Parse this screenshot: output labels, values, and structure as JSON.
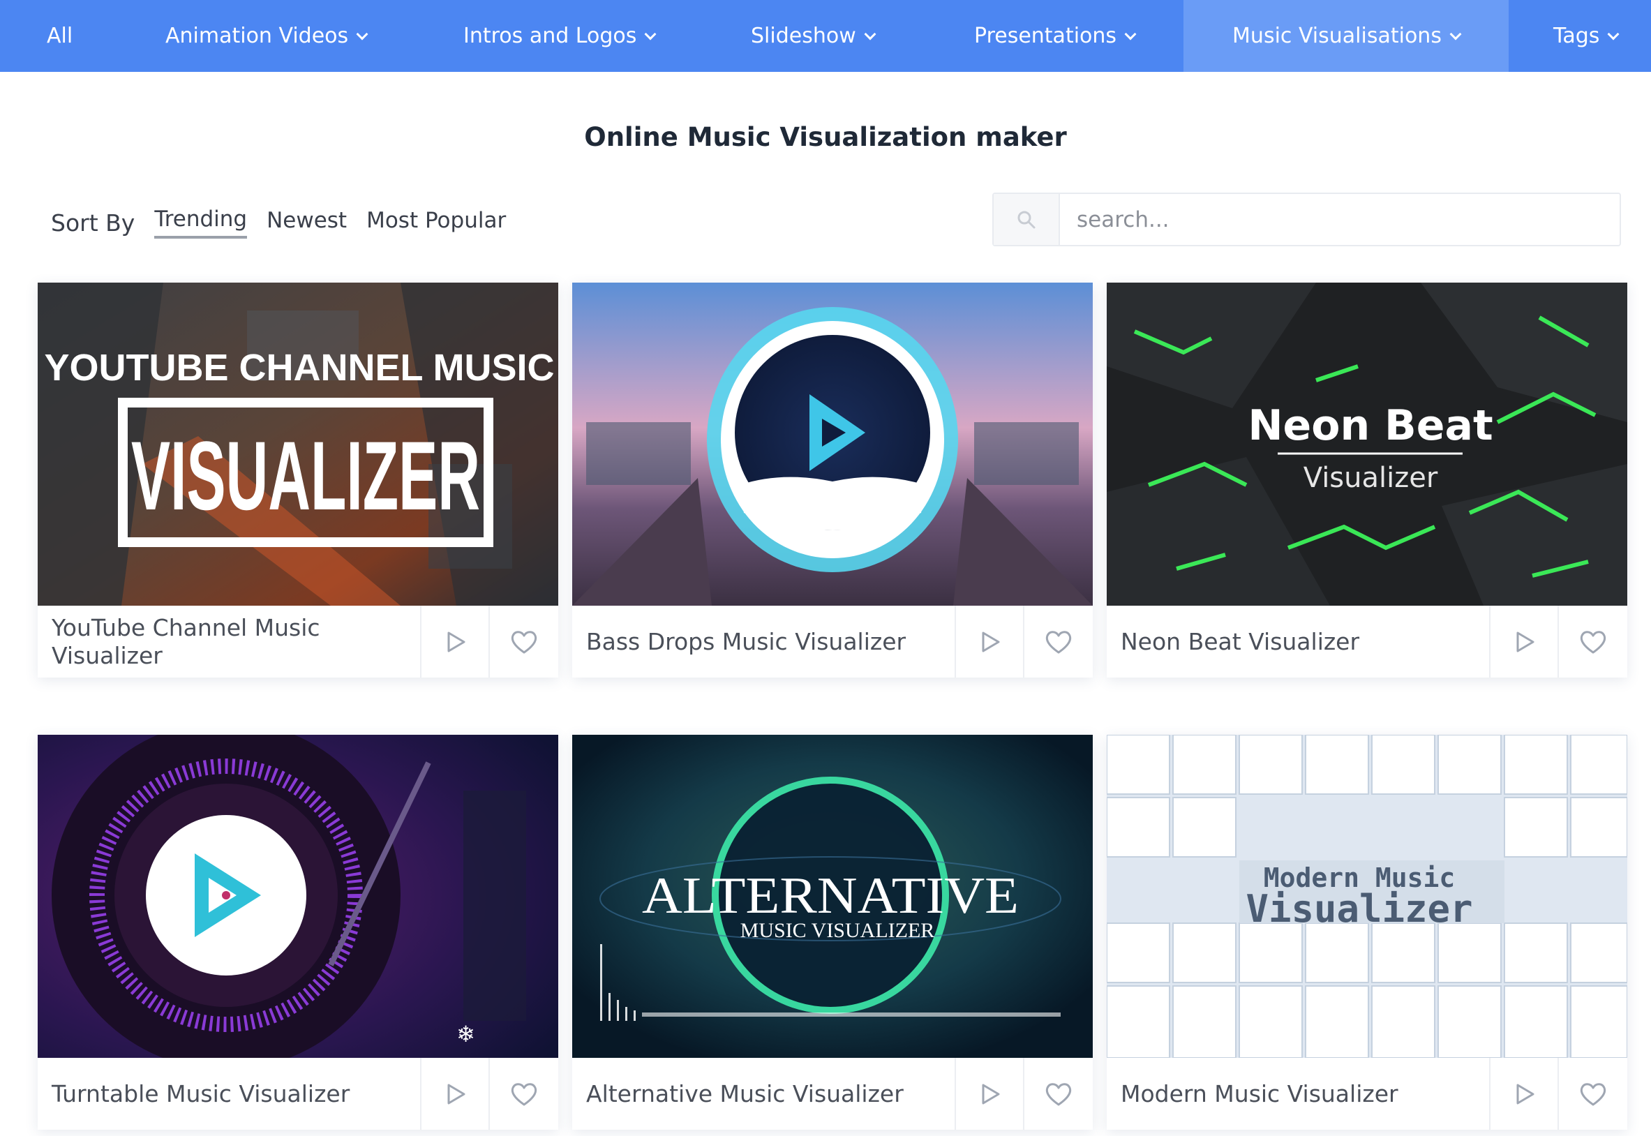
{
  "nav": {
    "items": [
      {
        "label": "All",
        "dropdown": false
      },
      {
        "label": "Animation Videos",
        "dropdown": true
      },
      {
        "label": "Intros and Logos",
        "dropdown": true
      },
      {
        "label": "Slideshow",
        "dropdown": true
      },
      {
        "label": "Presentations",
        "dropdown": true
      },
      {
        "label": "Music Visualisations",
        "dropdown": true,
        "active": true
      },
      {
        "label": "Tags",
        "dropdown": true
      }
    ]
  },
  "page": {
    "title": "Online Music Visualization maker"
  },
  "sort": {
    "label": "Sort By",
    "options": [
      "Trending",
      "Newest",
      "Most Popular"
    ],
    "active": "Trending"
  },
  "search": {
    "placeholder": "search..."
  },
  "cards": [
    {
      "title": "YouTube Channel Music Visualizer",
      "thumb_text": [
        "YOUTUBE CHANNEL MUSIC",
        "VISUALIZER"
      ]
    },
    {
      "title": "Bass Drops Music Visualizer",
      "thumb_text": []
    },
    {
      "title": "Neon Beat Visualizer",
      "thumb_text": [
        "Neon Beat",
        "Visualizer"
      ]
    },
    {
      "title": "Turntable Music Visualizer",
      "thumb_text": []
    },
    {
      "title": "Alternative Music Visualizer",
      "thumb_text": [
        "ALTERNATIVE",
        "MUSIC VISUALIZER"
      ]
    },
    {
      "title": "Modern Music Visualizer",
      "thumb_text": [
        "Modern Music",
        "Visualizer"
      ]
    }
  ],
  "icons": {
    "play": "play-icon",
    "like": "heart-icon",
    "search": "search-icon",
    "dropdown": "chevron-down-icon"
  },
  "colors": {
    "nav_bg": "#4c86f2",
    "nav_active": "#6a9cf6",
    "neon": "#3cf25a",
    "accent_cyan": "#36d2e6"
  }
}
